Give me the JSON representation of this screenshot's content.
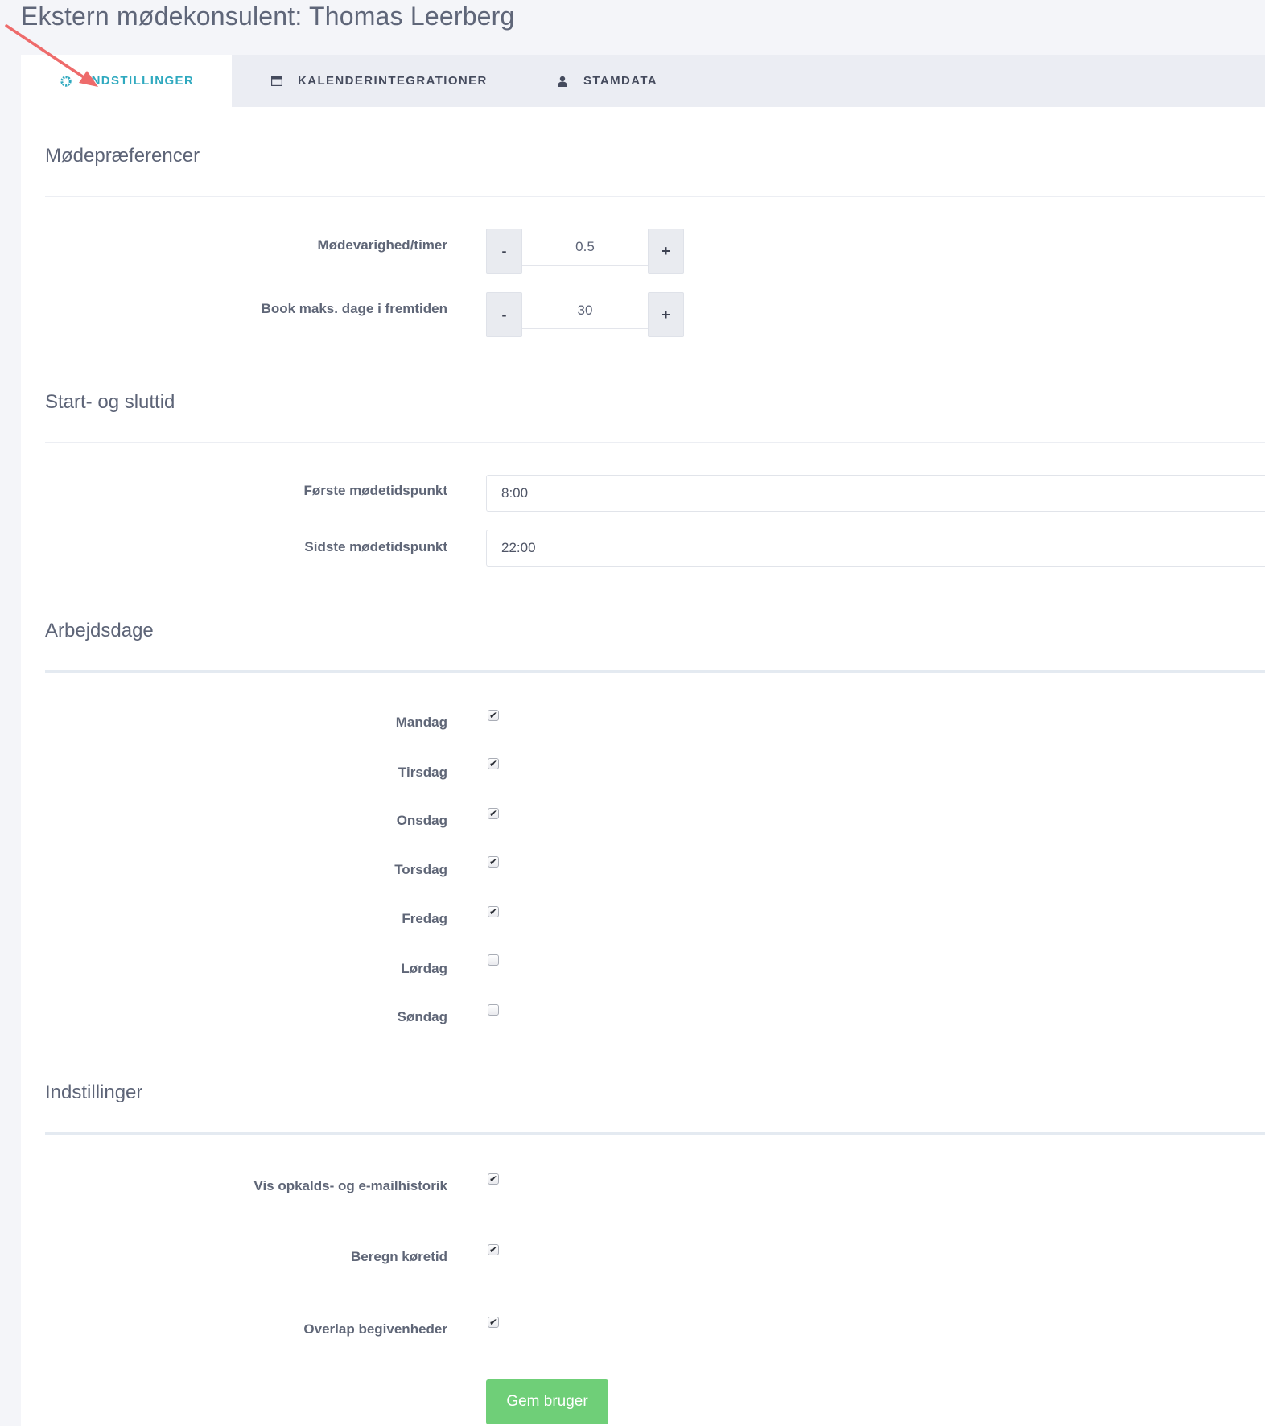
{
  "page": {
    "title": "Ekstern mødekonsulent: Thomas Leerberg"
  },
  "tabs": [
    {
      "label": "INDSTILLINGER",
      "icon": "gear-icon",
      "active": true
    },
    {
      "label": "KALENDERINTEGRATIONER",
      "icon": "calendar-icon",
      "active": false
    },
    {
      "label": "STAMDATA",
      "icon": "user-icon",
      "active": false
    }
  ],
  "meeting_prefs": {
    "title": "Mødepræferencer",
    "duration": {
      "label": "Mødevarighed/timer",
      "value": "0.5",
      "decrement": "-",
      "increment": "+"
    },
    "max_days": {
      "label": "Book maks. dage i fremtiden",
      "value": "30",
      "decrement": "-",
      "increment": "+"
    }
  },
  "start_end": {
    "title": "Start- og sluttid",
    "first": {
      "label": "Første mødetidspunkt",
      "value": "8:00"
    },
    "last": {
      "label": "Sidste mødetidspunkt",
      "value": "22:00"
    }
  },
  "workdays": {
    "title": "Arbejdsdage",
    "days": [
      {
        "label": "Mandag",
        "checked": true
      },
      {
        "label": "Tirsdag",
        "checked": true
      },
      {
        "label": "Onsdag",
        "checked": true
      },
      {
        "label": "Torsdag",
        "checked": true
      },
      {
        "label": "Fredag",
        "checked": true
      },
      {
        "label": "Lørdag",
        "checked": false
      },
      {
        "label": "Søndag",
        "checked": false
      }
    ]
  },
  "settings": {
    "title": "Indstillinger",
    "options": [
      {
        "label": "Vis opkalds- og e-mailhistorik",
        "checked": true
      },
      {
        "label": "Beregn køretid",
        "checked": true
      },
      {
        "label": "Overlap begivenheder",
        "checked": true
      }
    ]
  },
  "actions": {
    "save_label": "Gem bruger"
  },
  "colors": {
    "active_tab": "#2fa9bf",
    "save_button": "#6fcf78",
    "annotation_arrow": "#ee6b6b"
  }
}
